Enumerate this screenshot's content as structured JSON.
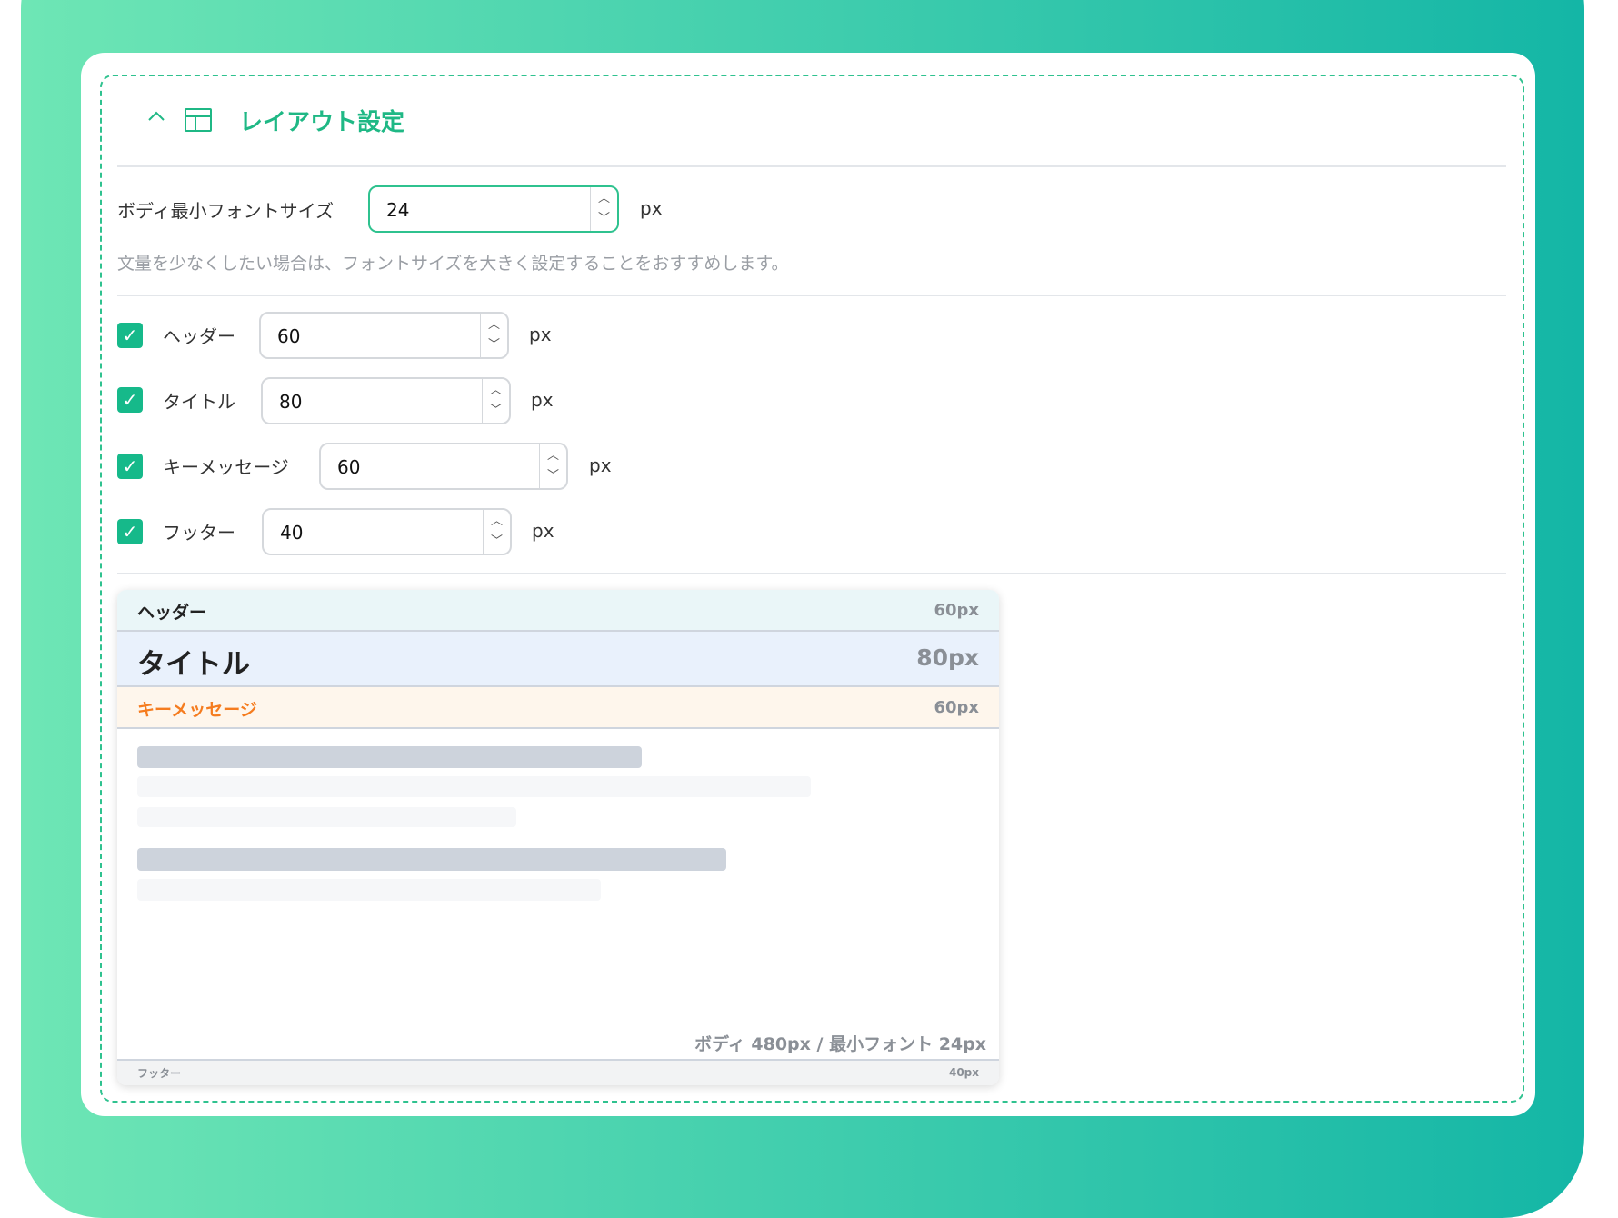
{
  "section": {
    "title": "レイアウト設定",
    "collapse_icon": "chevron-up-icon",
    "layout_icon": "layout-icon"
  },
  "body_font": {
    "label": "ボディ最小フォントサイズ",
    "value": "24",
    "unit": "px",
    "hint": "文量を少なくしたい場合は、フォントサイズを大きく設定することをおすすめします。"
  },
  "rows": [
    {
      "label": "ヘッダー",
      "value": "60",
      "unit": "px",
      "checked": true
    },
    {
      "label": "タイトル",
      "value": "80",
      "unit": "px",
      "checked": true
    },
    {
      "label": "キーメッセージ",
      "value": "60",
      "unit": "px",
      "checked": true
    },
    {
      "label": "フッター",
      "value": "40",
      "unit": "px",
      "checked": true
    }
  ],
  "preview": {
    "header": {
      "label": "ヘッダー",
      "size": "60px"
    },
    "title": {
      "label": "タイトル",
      "size": "80px"
    },
    "key": {
      "label": "キーメッセージ",
      "size": "60px"
    },
    "body_caption": "ボディ 480px / 最小フォント 24px",
    "footer": {
      "label": "フッター",
      "size": "40px"
    }
  },
  "colors": {
    "accent": "#1fb885",
    "key_text": "#f57c1f"
  }
}
